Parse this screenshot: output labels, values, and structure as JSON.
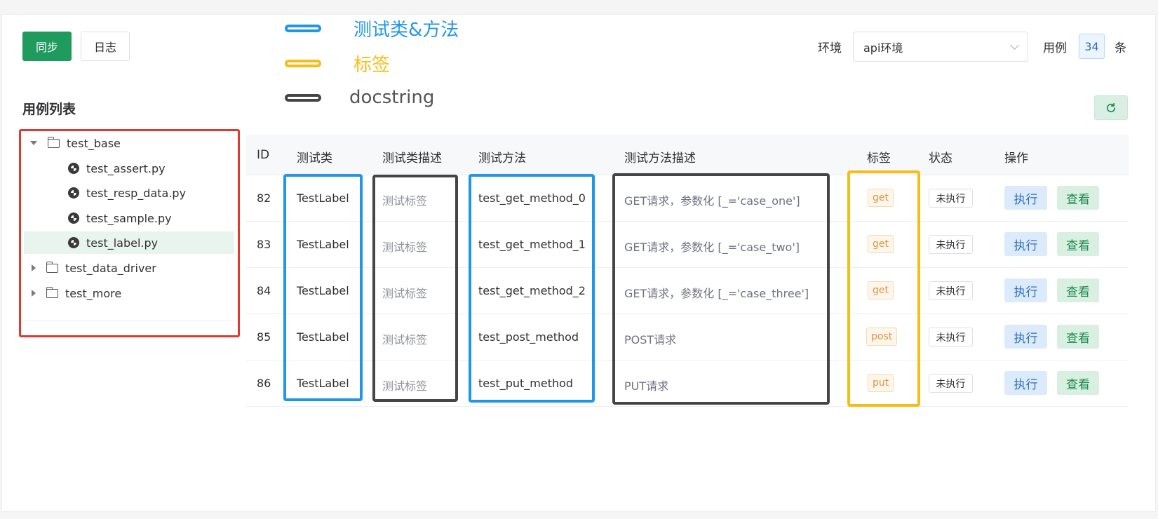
{
  "toolbar": {
    "sync_label": "同步",
    "log_label": "日志"
  },
  "legend": [
    {
      "text": "测试类&方法",
      "color": "#2196e9"
    },
    {
      "text": "标签",
      "color": "#f5bd18"
    },
    {
      "text": "docstring",
      "color": "#454545"
    }
  ],
  "env": {
    "label": "环境",
    "selected": "api环境"
  },
  "case_count": {
    "label": "用例",
    "value": "34",
    "unit": "条"
  },
  "case_list": {
    "title": "用例列表",
    "nodes": [
      {
        "label": "test_base",
        "type": "folder",
        "expanded": true
      },
      {
        "label": "test_assert.py",
        "type": "file"
      },
      {
        "label": "test_resp_data.py",
        "type": "file"
      },
      {
        "label": "test_sample.py",
        "type": "file"
      },
      {
        "label": "test_label.py",
        "type": "file",
        "selected": true
      },
      {
        "label": "test_data_driver",
        "type": "folder",
        "expanded": false
      },
      {
        "label": "test_more",
        "type": "folder",
        "expanded": false
      }
    ]
  },
  "table": {
    "headers": [
      "ID",
      "测试类",
      "测试类描述",
      "测试方法",
      "测试方法描述",
      "标签",
      "状态",
      "操作"
    ],
    "rows": [
      {
        "id": "82",
        "class": "TestLabel",
        "class_desc": "测试标签",
        "method": "test_get_method_0",
        "method_desc": "GET请求，参数化 [_='case_one']",
        "tag": "get",
        "status": "未执行",
        "run": "执行",
        "view": "查看"
      },
      {
        "id": "83",
        "class": "TestLabel",
        "class_desc": "测试标签",
        "method": "test_get_method_1",
        "method_desc": "GET请求，参数化 [_='case_two']",
        "tag": "get",
        "status": "未执行",
        "run": "执行",
        "view": "查看"
      },
      {
        "id": "84",
        "class": "TestLabel",
        "class_desc": "测试标签",
        "method": "test_get_method_2",
        "method_desc": "GET请求，参数化 [_='case_three']",
        "tag": "get",
        "status": "未执行",
        "run": "执行",
        "view": "查看"
      },
      {
        "id": "85",
        "class": "TestLabel",
        "class_desc": "测试标签",
        "method": "test_post_method",
        "method_desc": "POST请求",
        "tag": "post",
        "status": "未执行",
        "run": "执行",
        "view": "查看"
      },
      {
        "id": "86",
        "class": "TestLabel",
        "class_desc": "测试标签",
        "method": "test_put_method",
        "method_desc": "PUT请求",
        "tag": "put",
        "status": "未执行",
        "run": "执行",
        "view": "查看"
      }
    ]
  },
  "icons": {
    "refresh": "refresh-icon",
    "folder": "folder-icon",
    "python_file": "python-file-icon"
  },
  "colors": {
    "primary": "#1e9b5d",
    "highlight_tree": "#e03a2f"
  }
}
